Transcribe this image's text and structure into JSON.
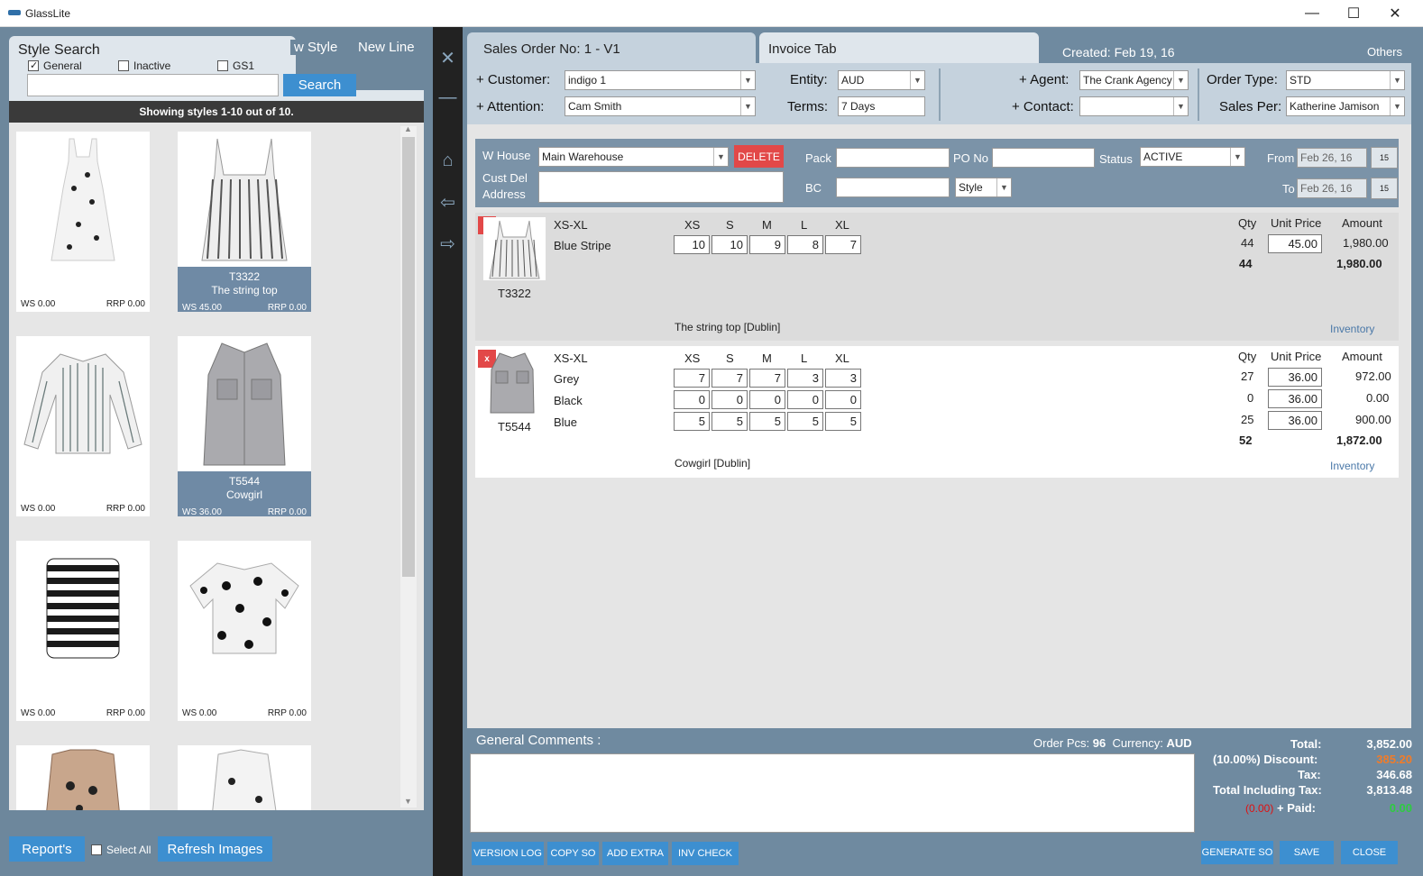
{
  "window": {
    "title": "GlassLite"
  },
  "left": {
    "tabs": {
      "style_search": "Style Search",
      "new_style": "w Style",
      "new_line": "New Line"
    },
    "filters": {
      "general": "General",
      "inactive": "Inactive",
      "gs1": "GS1"
    },
    "search_button": "Search",
    "search_value": "",
    "showing": "Showing styles 1-10 out of 10.",
    "cards": [
      {
        "code": "",
        "name": "",
        "ws": "WS 0.00",
        "rrp": "RRP 0.00",
        "selected": false
      },
      {
        "code": "T3322",
        "name": "The string top",
        "ws": "WS 45.00",
        "rrp": "RRP 0.00",
        "selected": true
      },
      {
        "code": "",
        "name": "",
        "ws": "WS 0.00",
        "rrp": "RRP 0.00",
        "selected": false
      },
      {
        "code": "T5544",
        "name": "Cowgirl",
        "ws": "WS 36.00",
        "rrp": "RRP 0.00",
        "selected": true
      },
      {
        "code": "",
        "name": "",
        "ws": "WS 0.00",
        "rrp": "RRP 0.00",
        "selected": false
      },
      {
        "code": "",
        "name": "",
        "ws": "WS 0.00",
        "rrp": "RRP 0.00",
        "selected": false
      }
    ],
    "reports_button": "Report's",
    "select_all": "Select All",
    "refresh_button": "Refresh Images"
  },
  "order": {
    "tab_sales": "Sales Order No:  1 - V1",
    "tab_invoice": "Invoice Tab",
    "created": "Created: Feb 19, 16",
    "others": "Others",
    "customer_label": "+ Customer:",
    "customer": "indigo 1",
    "attention_label": "+ Attention:",
    "attention": "Cam Smith",
    "entity_label": "Entity:",
    "entity": "AUD",
    "terms_label": "Terms:",
    "terms": "7 Days",
    "agent_label": "+ Agent:",
    "agent": "The Crank Agency",
    "contact_label": "+ Contact:",
    "contact": "",
    "order_type_label": "Order Type:",
    "order_type": "STD",
    "sales_per_label": "Sales Per:",
    "sales_per": "Katherine Jamison",
    "whouse_label": "W House",
    "whouse": "Main Warehouse",
    "delete": "DELETE",
    "cust_del_label": "Cust Del",
    "address_label": "Address",
    "pack_label": "Pack",
    "bc_label": "BC",
    "pono_label": "PO No",
    "status_label": "Status",
    "status": "ACTIVE",
    "style_select": "Style",
    "from_label": "From",
    "from": "Feb 26, 16",
    "to_label": "To",
    "to": "Feb 26, 16",
    "cal": "15"
  },
  "lines": [
    {
      "code": "T3322",
      "range": "XS-XL",
      "sizes": [
        "XS",
        "S",
        "M",
        "L",
        "XL"
      ],
      "rows": [
        {
          "colour": "Blue Stripe",
          "q": [
            "10",
            "10",
            "9",
            "8",
            "7"
          ],
          "qty": "44",
          "price": "45.00",
          "amount": "1,980.00"
        }
      ],
      "total_qty": "44",
      "total_amount": "1,980.00",
      "desc": "The string top [Dublin]",
      "inventory": "Inventory"
    },
    {
      "code": "T5544",
      "range": "XS-XL",
      "sizes": [
        "XS",
        "S",
        "M",
        "L",
        "XL"
      ],
      "rows": [
        {
          "colour": "Grey",
          "q": [
            "7",
            "7",
            "7",
            "3",
            "3"
          ],
          "qty": "27",
          "price": "36.00",
          "amount": "972.00"
        },
        {
          "colour": "Black",
          "q": [
            "0",
            "0",
            "0",
            "0",
            "0"
          ],
          "qty": "0",
          "price": "36.00",
          "amount": "0.00"
        },
        {
          "colour": "Blue",
          "q": [
            "5",
            "5",
            "5",
            "5",
            "5"
          ],
          "qty": "25",
          "price": "36.00",
          "amount": "900.00"
        }
      ],
      "total_qty": "52",
      "total_amount": "1,872.00",
      "desc": "Cowgirl [Dublin]",
      "inventory": "Inventory"
    }
  ],
  "headers": {
    "qty": "Qty",
    "unit_price": "Unit Price",
    "amount": "Amount",
    "x": "x"
  },
  "footer": {
    "comments_label": "General Comments :",
    "order_pcs_label": "Order Pcs:",
    "order_pcs": "96",
    "currency_label": "Currency:",
    "currency": "AUD",
    "total_label": "Total:",
    "total": "3,852.00",
    "discount_label": "(10.00%) Discount:",
    "discount": "385.20",
    "tax_label": "Tax:",
    "tax": "346.68",
    "total_tax_label": "Total Including Tax:",
    "total_tax": "3,813.48",
    "owing": "(0.00)",
    "paid_label": "+ Paid:",
    "paid": "0.00",
    "buttons": [
      "VERSION LOG",
      "COPY SO",
      "ADD EXTRA",
      "INV CHECK"
    ],
    "right_buttons": [
      "GENERATE SO",
      "SAVE",
      "CLOSE"
    ]
  },
  "colors": {
    "accent": "#3d8fd0",
    "delete": "#e24848",
    "discount": "#f07c2a",
    "paid": "#2ecc40",
    "owing": "#e01010"
  }
}
